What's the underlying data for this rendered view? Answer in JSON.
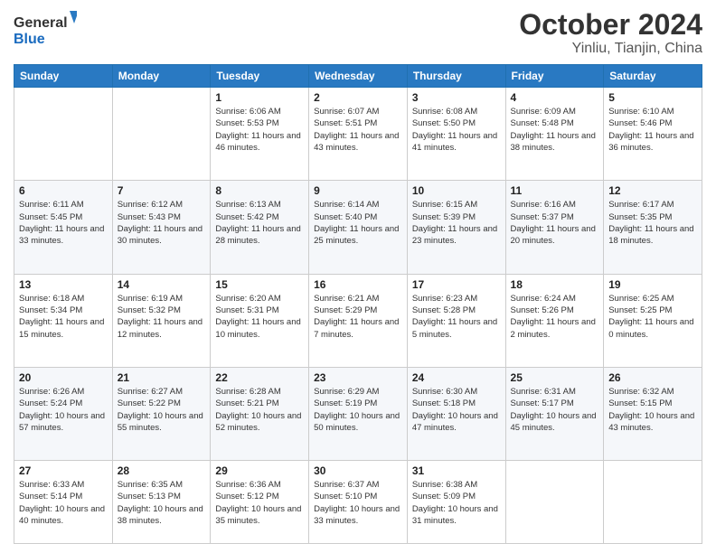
{
  "header": {
    "logo_general": "General",
    "logo_blue": "Blue",
    "title": "October 2024",
    "subtitle": "Yinliu, Tianjin, China"
  },
  "weekdays": [
    "Sunday",
    "Monday",
    "Tuesday",
    "Wednesday",
    "Thursday",
    "Friday",
    "Saturday"
  ],
  "weeks": [
    [
      {
        "day": "",
        "sunrise": "",
        "sunset": "",
        "daylight": ""
      },
      {
        "day": "",
        "sunrise": "",
        "sunset": "",
        "daylight": ""
      },
      {
        "day": "1",
        "sunrise": "Sunrise: 6:06 AM",
        "sunset": "Sunset: 5:53 PM",
        "daylight": "Daylight: 11 hours and 46 minutes."
      },
      {
        "day": "2",
        "sunrise": "Sunrise: 6:07 AM",
        "sunset": "Sunset: 5:51 PM",
        "daylight": "Daylight: 11 hours and 43 minutes."
      },
      {
        "day": "3",
        "sunrise": "Sunrise: 6:08 AM",
        "sunset": "Sunset: 5:50 PM",
        "daylight": "Daylight: 11 hours and 41 minutes."
      },
      {
        "day": "4",
        "sunrise": "Sunrise: 6:09 AM",
        "sunset": "Sunset: 5:48 PM",
        "daylight": "Daylight: 11 hours and 38 minutes."
      },
      {
        "day": "5",
        "sunrise": "Sunrise: 6:10 AM",
        "sunset": "Sunset: 5:46 PM",
        "daylight": "Daylight: 11 hours and 36 minutes."
      }
    ],
    [
      {
        "day": "6",
        "sunrise": "Sunrise: 6:11 AM",
        "sunset": "Sunset: 5:45 PM",
        "daylight": "Daylight: 11 hours and 33 minutes."
      },
      {
        "day": "7",
        "sunrise": "Sunrise: 6:12 AM",
        "sunset": "Sunset: 5:43 PM",
        "daylight": "Daylight: 11 hours and 30 minutes."
      },
      {
        "day": "8",
        "sunrise": "Sunrise: 6:13 AM",
        "sunset": "Sunset: 5:42 PM",
        "daylight": "Daylight: 11 hours and 28 minutes."
      },
      {
        "day": "9",
        "sunrise": "Sunrise: 6:14 AM",
        "sunset": "Sunset: 5:40 PM",
        "daylight": "Daylight: 11 hours and 25 minutes."
      },
      {
        "day": "10",
        "sunrise": "Sunrise: 6:15 AM",
        "sunset": "Sunset: 5:39 PM",
        "daylight": "Daylight: 11 hours and 23 minutes."
      },
      {
        "day": "11",
        "sunrise": "Sunrise: 6:16 AM",
        "sunset": "Sunset: 5:37 PM",
        "daylight": "Daylight: 11 hours and 20 minutes."
      },
      {
        "day": "12",
        "sunrise": "Sunrise: 6:17 AM",
        "sunset": "Sunset: 5:35 PM",
        "daylight": "Daylight: 11 hours and 18 minutes."
      }
    ],
    [
      {
        "day": "13",
        "sunrise": "Sunrise: 6:18 AM",
        "sunset": "Sunset: 5:34 PM",
        "daylight": "Daylight: 11 hours and 15 minutes."
      },
      {
        "day": "14",
        "sunrise": "Sunrise: 6:19 AM",
        "sunset": "Sunset: 5:32 PM",
        "daylight": "Daylight: 11 hours and 12 minutes."
      },
      {
        "day": "15",
        "sunrise": "Sunrise: 6:20 AM",
        "sunset": "Sunset: 5:31 PM",
        "daylight": "Daylight: 11 hours and 10 minutes."
      },
      {
        "day": "16",
        "sunrise": "Sunrise: 6:21 AM",
        "sunset": "Sunset: 5:29 PM",
        "daylight": "Daylight: 11 hours and 7 minutes."
      },
      {
        "day": "17",
        "sunrise": "Sunrise: 6:23 AM",
        "sunset": "Sunset: 5:28 PM",
        "daylight": "Daylight: 11 hours and 5 minutes."
      },
      {
        "day": "18",
        "sunrise": "Sunrise: 6:24 AM",
        "sunset": "Sunset: 5:26 PM",
        "daylight": "Daylight: 11 hours and 2 minutes."
      },
      {
        "day": "19",
        "sunrise": "Sunrise: 6:25 AM",
        "sunset": "Sunset: 5:25 PM",
        "daylight": "Daylight: 11 hours and 0 minutes."
      }
    ],
    [
      {
        "day": "20",
        "sunrise": "Sunrise: 6:26 AM",
        "sunset": "Sunset: 5:24 PM",
        "daylight": "Daylight: 10 hours and 57 minutes."
      },
      {
        "day": "21",
        "sunrise": "Sunrise: 6:27 AM",
        "sunset": "Sunset: 5:22 PM",
        "daylight": "Daylight: 10 hours and 55 minutes."
      },
      {
        "day": "22",
        "sunrise": "Sunrise: 6:28 AM",
        "sunset": "Sunset: 5:21 PM",
        "daylight": "Daylight: 10 hours and 52 minutes."
      },
      {
        "day": "23",
        "sunrise": "Sunrise: 6:29 AM",
        "sunset": "Sunset: 5:19 PM",
        "daylight": "Daylight: 10 hours and 50 minutes."
      },
      {
        "day": "24",
        "sunrise": "Sunrise: 6:30 AM",
        "sunset": "Sunset: 5:18 PM",
        "daylight": "Daylight: 10 hours and 47 minutes."
      },
      {
        "day": "25",
        "sunrise": "Sunrise: 6:31 AM",
        "sunset": "Sunset: 5:17 PM",
        "daylight": "Daylight: 10 hours and 45 minutes."
      },
      {
        "day": "26",
        "sunrise": "Sunrise: 6:32 AM",
        "sunset": "Sunset: 5:15 PM",
        "daylight": "Daylight: 10 hours and 43 minutes."
      }
    ],
    [
      {
        "day": "27",
        "sunrise": "Sunrise: 6:33 AM",
        "sunset": "Sunset: 5:14 PM",
        "daylight": "Daylight: 10 hours and 40 minutes."
      },
      {
        "day": "28",
        "sunrise": "Sunrise: 6:35 AM",
        "sunset": "Sunset: 5:13 PM",
        "daylight": "Daylight: 10 hours and 38 minutes."
      },
      {
        "day": "29",
        "sunrise": "Sunrise: 6:36 AM",
        "sunset": "Sunset: 5:12 PM",
        "daylight": "Daylight: 10 hours and 35 minutes."
      },
      {
        "day": "30",
        "sunrise": "Sunrise: 6:37 AM",
        "sunset": "Sunset: 5:10 PM",
        "daylight": "Daylight: 10 hours and 33 minutes."
      },
      {
        "day": "31",
        "sunrise": "Sunrise: 6:38 AM",
        "sunset": "Sunset: 5:09 PM",
        "daylight": "Daylight: 10 hours and 31 minutes."
      },
      {
        "day": "",
        "sunrise": "",
        "sunset": "",
        "daylight": ""
      },
      {
        "day": "",
        "sunrise": "",
        "sunset": "",
        "daylight": ""
      }
    ]
  ]
}
